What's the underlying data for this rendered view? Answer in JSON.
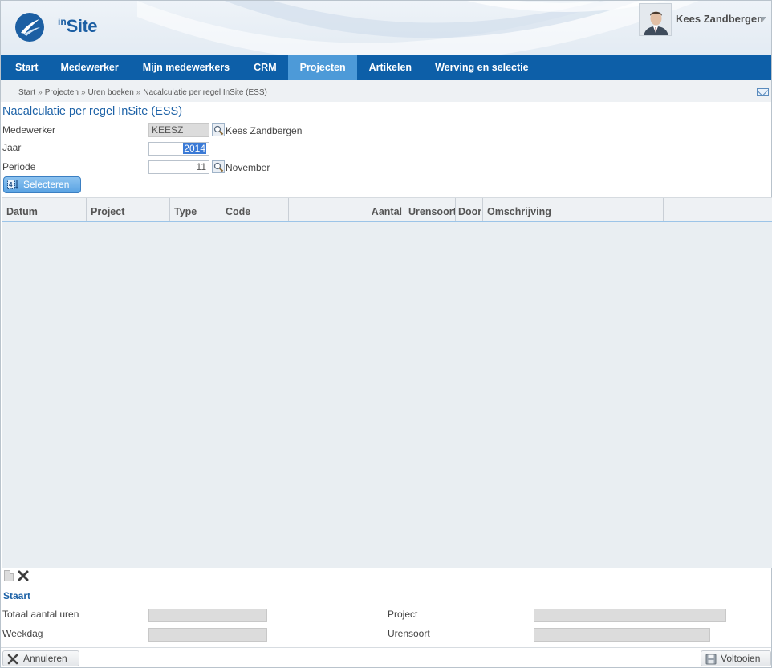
{
  "header": {
    "logo_prefix": "in",
    "logo_name": "Site",
    "user_name": "Kees Zandbergen"
  },
  "nav": {
    "items": [
      "Start",
      "Medewerker",
      "Mijn medewerkers",
      "CRM",
      "Projecten",
      "Artikelen",
      "Werving en selectie"
    ],
    "active": "Projecten"
  },
  "breadcrumb": [
    "Start",
    "Projecten",
    "Uren boeken",
    "Nacalculatie per regel InSite (ESS)"
  ],
  "page": {
    "title": "Nacalculatie per regel InSite (ESS)"
  },
  "form": {
    "medewerker_label": "Medewerker",
    "medewerker_value": "KEESZ",
    "medewerker_name": "Kees Zandbergen",
    "jaar_label": "Jaar",
    "jaar_value": "2014",
    "periode_label": "Periode",
    "periode_value": "11",
    "periode_name": "November",
    "select_button": "Selecteren"
  },
  "grid": {
    "columns": [
      "Datum",
      "Project",
      "Type",
      "Code",
      "Aantal",
      "Urensoort",
      "Door",
      "Omschrijving"
    ]
  },
  "footer_section": {
    "title": "Staart",
    "totaal_label": "Totaal aantal uren",
    "weekdag_label": "Weekdag",
    "project_label": "Project",
    "urensoort_label": "Urensoort"
  },
  "buttons": {
    "cancel": "Annuleren",
    "finish": "Voltooien"
  },
  "colors": {
    "nav_bg": "#0d5fa8",
    "nav_active": "#4d9ad8",
    "title_blue": "#1d62a7"
  }
}
